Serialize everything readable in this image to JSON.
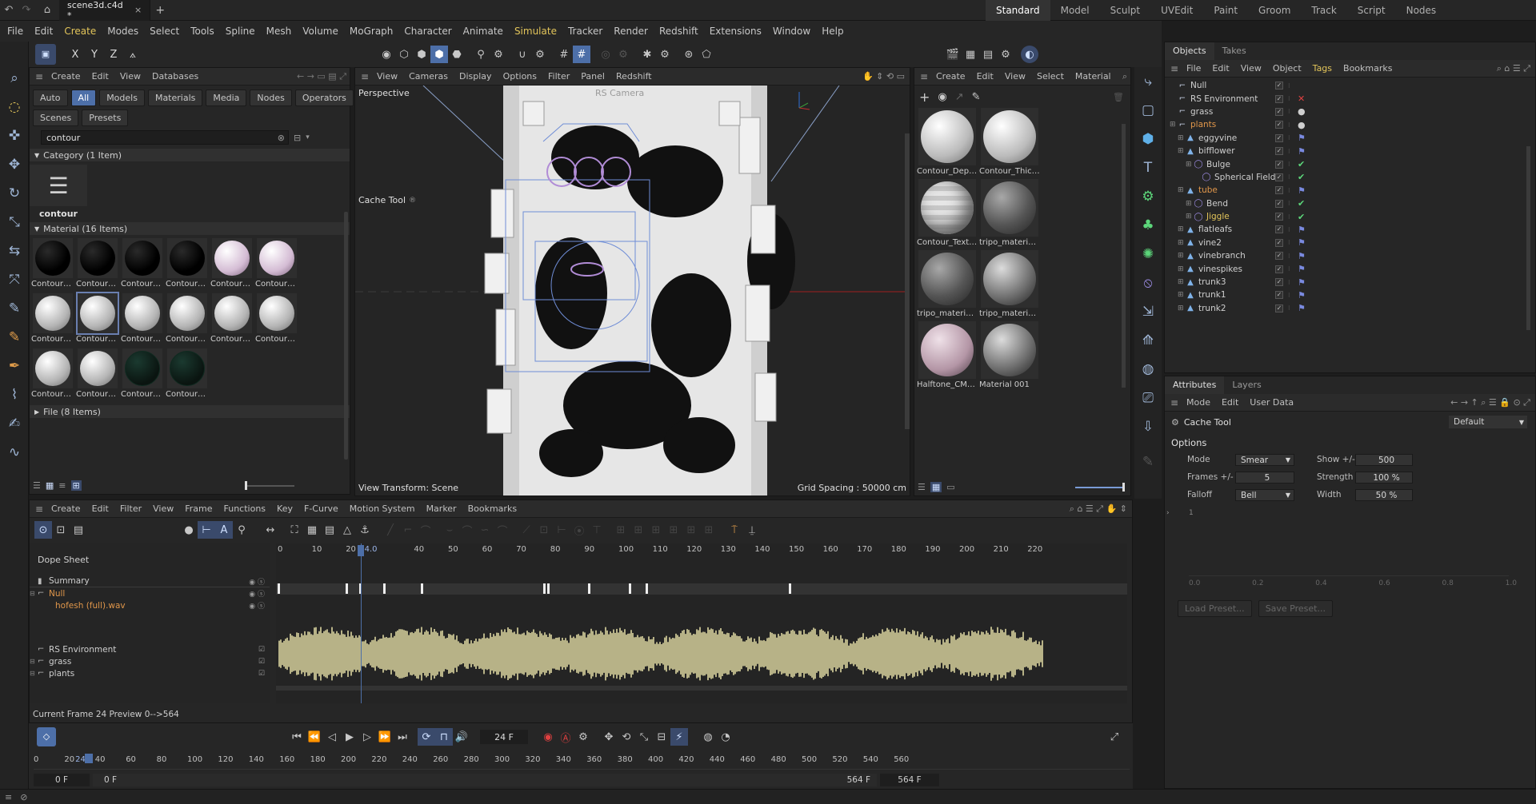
{
  "top": {
    "file_tab": "scene3d.c4d *",
    "layouts": [
      "Standard",
      "Model",
      "Sculpt",
      "UVEdit",
      "Paint",
      "Groom",
      "Track",
      "Script",
      "Nodes"
    ],
    "active_layout": "Standard"
  },
  "menubar": [
    "File",
    "Edit",
    "Create",
    "Modes",
    "Select",
    "Tools",
    "Spline",
    "Mesh",
    "Volume",
    "MoGraph",
    "Character",
    "Animate",
    "Simulate",
    "Tracker",
    "Render",
    "Redshift",
    "Extensions",
    "Window",
    "Help"
  ],
  "asset_browser": {
    "menu": [
      "Create",
      "Edit",
      "View",
      "Databases"
    ],
    "filter_buttons": [
      "Auto",
      "All",
      "Models",
      "Materials",
      "Media",
      "Nodes",
      "Operators"
    ],
    "filter_buttons2": [
      "Scenes",
      "Presets"
    ],
    "search_value": "contour",
    "category_header": "Category (1 Item)",
    "category_item": "contour",
    "material_header": "Material (16 Items)",
    "material_labels": [
      "Contour_...",
      "Contour_...",
      "Contour_...",
      "Contour_...",
      "Contour_...",
      "Contour_...",
      "Contour_...",
      "Contour_...",
      "Contour_...",
      "Contour_...",
      "Contour_...",
      "Contour_...",
      "Contour_...",
      "Contour_...",
      "Contour_...",
      "Contour_..."
    ],
    "file_header": "File (8 Items)"
  },
  "viewport": {
    "menu": [
      "View",
      "Cameras",
      "Display",
      "Options",
      "Filter",
      "Panel",
      "Redshift"
    ],
    "label": "Perspective",
    "camera_label": "RS Camera",
    "tool_label": "Cache Tool",
    "view_transform": "View Transform: Scene",
    "grid_spacing": "Grid Spacing : 50000 cm"
  },
  "material_manager": {
    "menu": [
      "Create",
      "Edit",
      "View",
      "Select",
      "Material"
    ],
    "items": [
      "Contour_Depth_C",
      "Contour_Thicknes",
      "Contour_Textured",
      "tripo_material_f7c",
      "tripo_material_5af",
      "tripo_material_4be",
      "Halftone_CMYK_P",
      "Material 001"
    ]
  },
  "objects": {
    "tabs": [
      "Objects",
      "Takes"
    ],
    "menu": [
      "File",
      "Edit",
      "View",
      "Object",
      "Tags",
      "Bookmarks"
    ],
    "rows": [
      {
        "name": "Null",
        "indent": 0,
        "color": "normal",
        "tag": ""
      },
      {
        "name": "RS Environment",
        "indent": 0,
        "color": "normal",
        "tag": "x"
      },
      {
        "name": "grass",
        "indent": 0,
        "color": "normal",
        "tag": "ball"
      },
      {
        "name": "plants",
        "indent": 0,
        "color": "orange",
        "tag": "ball"
      },
      {
        "name": "eggyvine",
        "indent": 1,
        "color": "normal",
        "tag": "flag"
      },
      {
        "name": "bifflower",
        "indent": 1,
        "color": "normal",
        "tag": "flag"
      },
      {
        "name": "Bulge",
        "indent": 2,
        "color": "normal",
        "tag": "check"
      },
      {
        "name": "Spherical Field",
        "indent": 3,
        "color": "normal",
        "tag": "check"
      },
      {
        "name": "tube",
        "indent": 1,
        "color": "orange",
        "tag": "flag"
      },
      {
        "name": "Bend",
        "indent": 2,
        "color": "normal",
        "tag": "check"
      },
      {
        "name": "Jiggle",
        "indent": 2,
        "color": "yellow",
        "tag": "check"
      },
      {
        "name": "flatleafs",
        "indent": 1,
        "color": "normal",
        "tag": "flag"
      },
      {
        "name": "vine2",
        "indent": 1,
        "color": "normal",
        "tag": "flag"
      },
      {
        "name": "vinebranch",
        "indent": 1,
        "color": "normal",
        "tag": "flag"
      },
      {
        "name": "vinespikes",
        "indent": 1,
        "color": "normal",
        "tag": "flag"
      },
      {
        "name": "trunk3",
        "indent": 1,
        "color": "normal",
        "tag": "flag"
      },
      {
        "name": "trunk1",
        "indent": 1,
        "color": "normal",
        "tag": "flag"
      },
      {
        "name": "trunk2",
        "indent": 1,
        "color": "normal",
        "tag": "flag"
      }
    ]
  },
  "attributes": {
    "tabs": [
      "Attributes",
      "Layers"
    ],
    "menu": [
      "Mode",
      "Edit",
      "User Data"
    ],
    "object_name": "Cache Tool",
    "preset": "Default",
    "section": "Options",
    "mode_label": "Mode",
    "mode_value": "Smear",
    "show_label": "Show +/-",
    "show_value": "500",
    "frames_label": "Frames +/-",
    "frames_value": "5",
    "strength_label": "Strength",
    "strength_value": "100 %",
    "falloff_label": "Falloff",
    "falloff_value": "Bell",
    "width_label": "Width",
    "width_value": "50 %",
    "curve_y": "1",
    "curve_x": [
      "0.0",
      "0.2",
      "0.4",
      "0.6",
      "0.8",
      "1.0"
    ],
    "load_preset": "Load Preset...",
    "save_preset": "Save Preset..."
  },
  "timeline": {
    "menu": [
      "Create",
      "Edit",
      "Filter",
      "View",
      "Frame",
      "Functions",
      "Key",
      "F-Curve",
      "Motion System",
      "Marker",
      "Bookmarks"
    ],
    "title": "Dope Sheet",
    "ruler": [
      "0",
      "10",
      "20",
      "24.0",
      "40",
      "50",
      "60",
      "70",
      "80",
      "90",
      "100",
      "110",
      "120",
      "130",
      "140",
      "150",
      "160",
      "170",
      "180",
      "190",
      "200",
      "210",
      "220"
    ],
    "tracks": [
      {
        "name": "Summary",
        "color": "normal"
      },
      {
        "name": "Null",
        "color": "orange"
      },
      {
        "name": "hofesh (full).wav",
        "color": "orange"
      },
      {
        "name": "RS Environment",
        "color": "normal"
      },
      {
        "name": "grass",
        "color": "normal"
      },
      {
        "name": "plants",
        "color": "normal"
      }
    ],
    "status": "Current Frame  24  Preview  0-->564",
    "summary_keys": [
      0,
      20,
      24,
      31,
      42,
      78,
      79,
      91,
      103,
      108,
      150
    ]
  },
  "transport": {
    "frame": "24 F",
    "ruler": [
      "0",
      "20",
      "24",
      "40",
      "60",
      "80",
      "100",
      "120",
      "140",
      "160",
      "180",
      "200",
      "220",
      "240",
      "260",
      "280",
      "300",
      "320",
      "340",
      "360",
      "380",
      "400",
      "420",
      "440",
      "460",
      "480",
      "500",
      "520",
      "540",
      "560"
    ],
    "start": "0 F",
    "start2": "0 F",
    "end": "564 F",
    "end2": "564 F"
  }
}
